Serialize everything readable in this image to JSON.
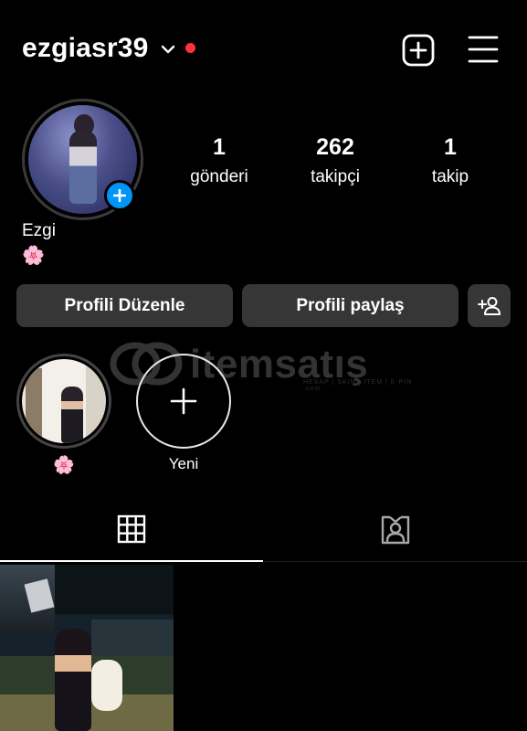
{
  "header": {
    "username": "ezgiasr39",
    "icons": [
      "chevron-down-icon",
      "notification-dot",
      "add-square-icon",
      "hamburger-menu-icon"
    ],
    "notification_dot_color": "#ff3040"
  },
  "profile": {
    "avatar_add_color": "#0095f6",
    "display_name": "Ezgi",
    "bio": "🌸",
    "stats": [
      {
        "value": "1",
        "label": "gönderi"
      },
      {
        "value": "262",
        "label": "takipçi"
      },
      {
        "value": "1",
        "label": "takip"
      }
    ]
  },
  "actions": {
    "edit_label": "Profili Düzenle",
    "share_label": "Profili paylaş",
    "discover_people_icon": "add-person-icon"
  },
  "watermark": {
    "text": "itemsatış",
    "tagline": "HESAP | SKIN | ITEM | E-PIN .com"
  },
  "highlights": [
    {
      "label": "🌸"
    },
    {
      "label": "Yeni",
      "icon": "plus-icon"
    }
  ],
  "tabs": [
    {
      "name": "grid",
      "icon": "grid-icon",
      "active": true
    },
    {
      "name": "tagged",
      "icon": "tagged-person-icon",
      "active": false
    }
  ]
}
